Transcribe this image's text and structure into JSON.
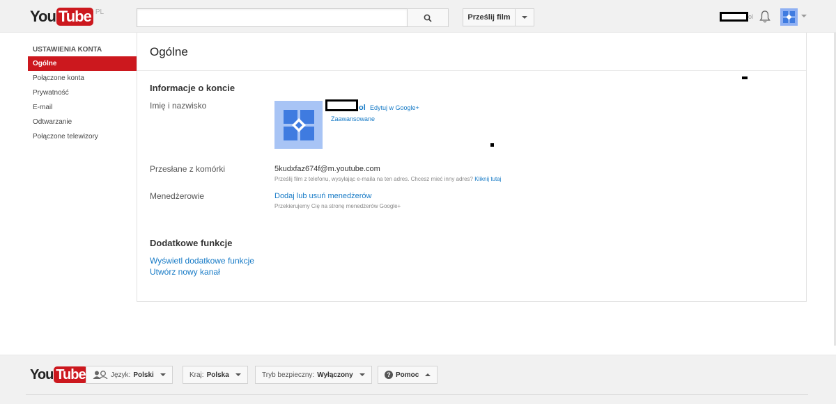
{
  "header": {
    "logo_you": "You",
    "logo_tube": "Tube",
    "logo_country": "PL",
    "search": {
      "value": "",
      "placeholder": ""
    },
    "upload_label": "Prześlij film",
    "user_suffix": "ol"
  },
  "sidebar": {
    "heading": "USTAWIENIA KONTA",
    "items": [
      {
        "label": "Ogólne",
        "active": true
      },
      {
        "label": "Połączone konta",
        "active": false
      },
      {
        "label": "Prywatność",
        "active": false
      },
      {
        "label": "E-mail",
        "active": false
      },
      {
        "label": "Odtwarzanie",
        "active": false
      },
      {
        "label": "Połączone telewizory",
        "active": false
      }
    ]
  },
  "main": {
    "title": "Ogólne",
    "account_info": {
      "title": "Informacje o koncie",
      "name_label": "Imię i nazwisko",
      "name_tail": "ol",
      "edit_gplus": "Edytuj w Google+",
      "advanced": "Zaawansowane",
      "mobile_label": "Przesłane z komórki",
      "mobile_email": "5kudxfaz674f@m.youtube.com",
      "mobile_help": "Prześlij film z telefonu, wysyłając e-maila na ten adres. Chcesz mieć inny adres?",
      "mobile_help_link": "Kliknij tutaj",
      "managers_label": "Menedżerowie",
      "managers_link": "Dodaj lub usuń menedżerów",
      "managers_help": "Przekierujemy Cię na stronę menedżerów Google+"
    },
    "extra": {
      "title": "Dodatkowe funkcje",
      "show_extra": "Wyświetl dodatkowe funkcje",
      "create_channel": "Utwórz nowy kanał"
    }
  },
  "footer": {
    "language_label": "Język:",
    "language_value": "Polski",
    "country_label": "Kraj:",
    "country_value": "Polska",
    "safety_label": "Tryb bezpieczny:",
    "safety_value": "Wyłączony",
    "help_label": "Pomoc"
  },
  "colors": {
    "brand_red": "#cc181e",
    "link_blue": "#167ac6",
    "avatar_blue": "#a8c4f5"
  }
}
